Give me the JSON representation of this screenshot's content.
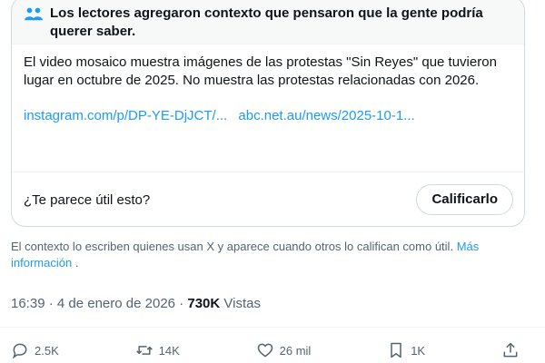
{
  "note": {
    "header": "Los lectores agregaron contexto que pensaron que la gente podría querer saber.",
    "text": "El video mosaico muestra imágenes de las protestas \"Sin Reyes\" que tuvieron lugar en octubre de 2025. No muestra las protestas relacionadas con 2026.",
    "links": [
      "instagram.com/p/DP-YE-DjJCT/...",
      "abc.net.au/news/2025-10-1..."
    ],
    "question": "¿Te parece útil esto?",
    "rate_label": "Calificarlo"
  },
  "disclaimer": {
    "text": "El contexto lo escriben quienes usan X y aparece cuando otros lo califican como útil.",
    "more_label": "Más información",
    "suffix": "."
  },
  "meta": {
    "time": "16:39",
    "separator": "·",
    "date": "4 de enero de 2026",
    "views_count": "730K",
    "views_label": "Vistas"
  },
  "actions": {
    "replies": "2.5K",
    "reposts": "14K",
    "likes": "26 mil",
    "bookmarks": "1K"
  },
  "icons": {
    "note_header": "people-icon",
    "reply": "reply-icon",
    "repost": "repost-icon",
    "like": "heart-icon",
    "bookmark": "bookmark-icon",
    "share": "share-icon"
  },
  "colors": {
    "accent": "#1d9bf0",
    "text": "#0f1419",
    "secondary": "#536471",
    "border": "#cfd9de",
    "header_bg": "#f7f9f9"
  }
}
